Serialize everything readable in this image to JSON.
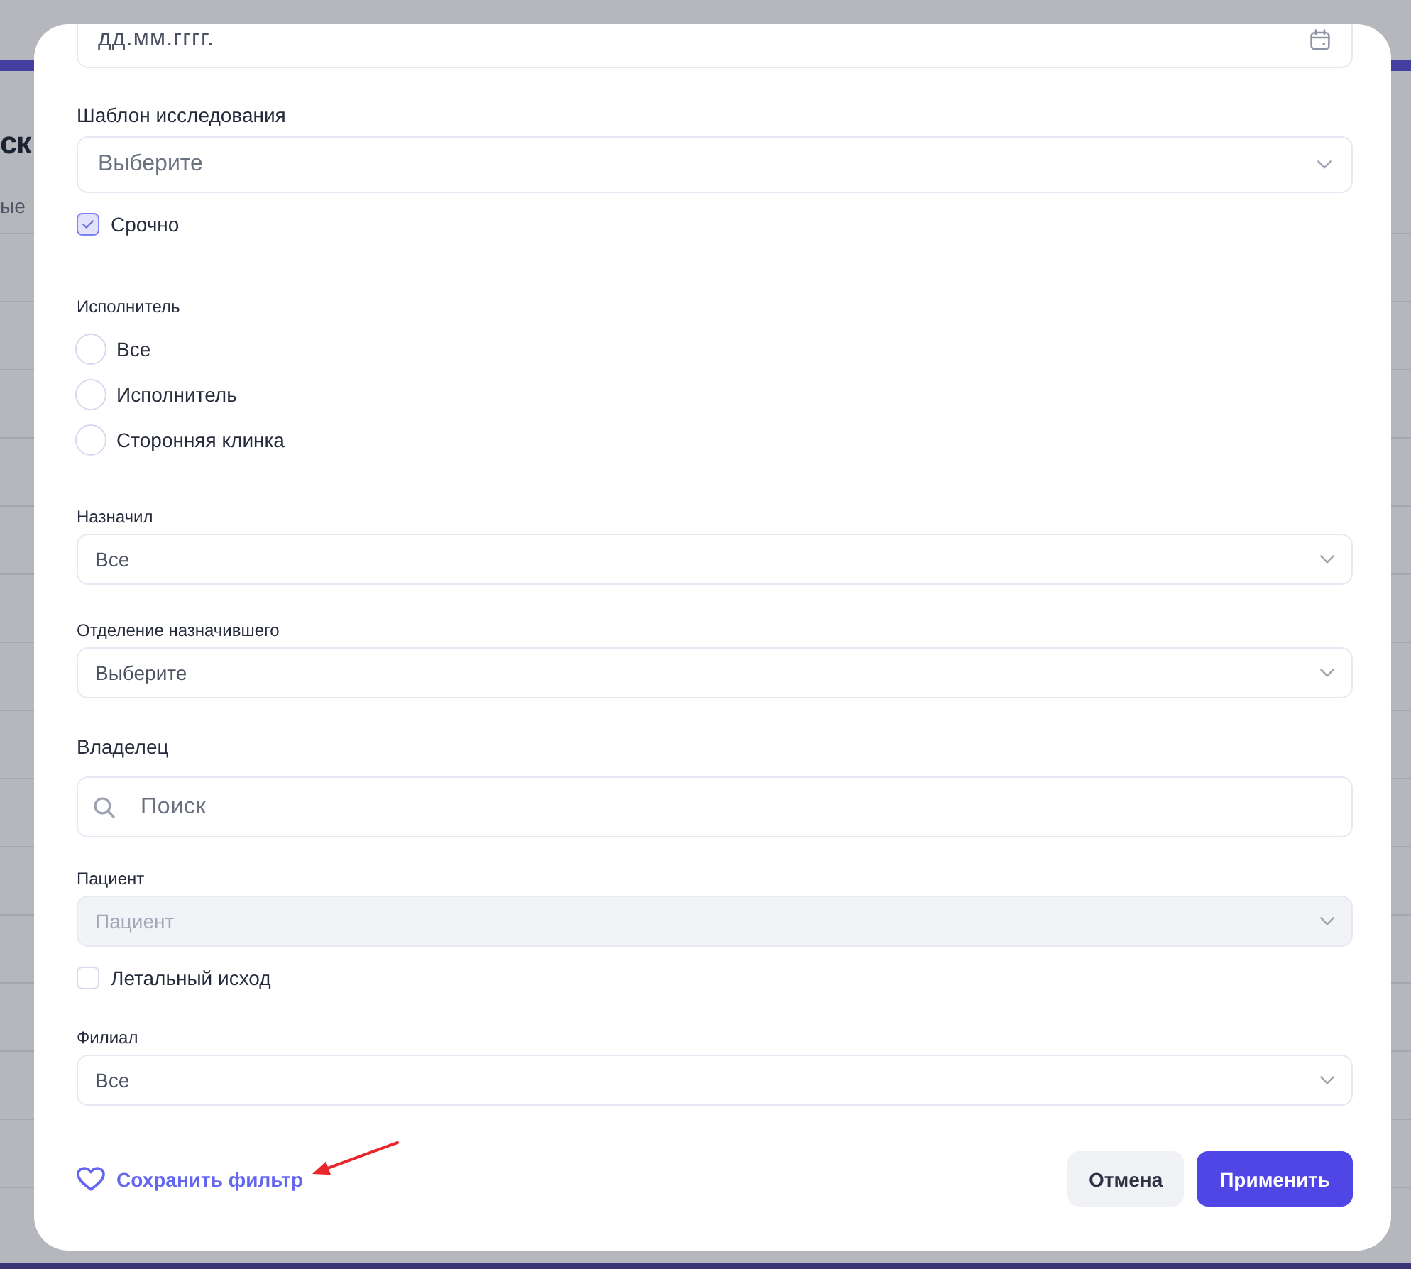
{
  "background": {
    "heading": "ск",
    "tab": "ые"
  },
  "filter_dialog": {
    "fields": [
      {
        "kind": "date",
        "placeholder": "дд.мм.гггг."
      },
      {
        "kind": "select",
        "label": "Шаблон исследования",
        "placeholder": "Выберите"
      },
      {
        "kind": "checkbox",
        "label": "Срочно",
        "checked": true
      },
      {
        "kind": "radio_group",
        "label": "Исполнитель",
        "options": [
          {
            "label": "Все",
            "selected": false
          },
          {
            "label": "Исполнитель",
            "selected": false
          },
          {
            "label": "Сторонняя клинка",
            "selected": false
          }
        ]
      },
      {
        "kind": "compact_select",
        "label": "Назначил",
        "value": "Все",
        "disabled": false
      },
      {
        "kind": "compact_select",
        "label": "Отделение назначившего",
        "placeholder": "Выберите",
        "disabled": false
      },
      {
        "kind": "search",
        "label": "Владелец",
        "placeholder": "Поиск"
      },
      {
        "kind": "compact_select",
        "label": "Пациент",
        "placeholder": "Пациент",
        "disabled": true
      },
      {
        "kind": "checkbox",
        "label": "Летальный исход",
        "checked": false
      },
      {
        "kind": "compact_select",
        "label": "Филиал",
        "value": "Все",
        "disabled": false
      }
    ],
    "save_filter": "Сохранить фильтр",
    "buttons": [
      {
        "label": "Отмена",
        "kind": "secondary"
      },
      {
        "label": "Применить",
        "kind": "primary"
      }
    ]
  }
}
